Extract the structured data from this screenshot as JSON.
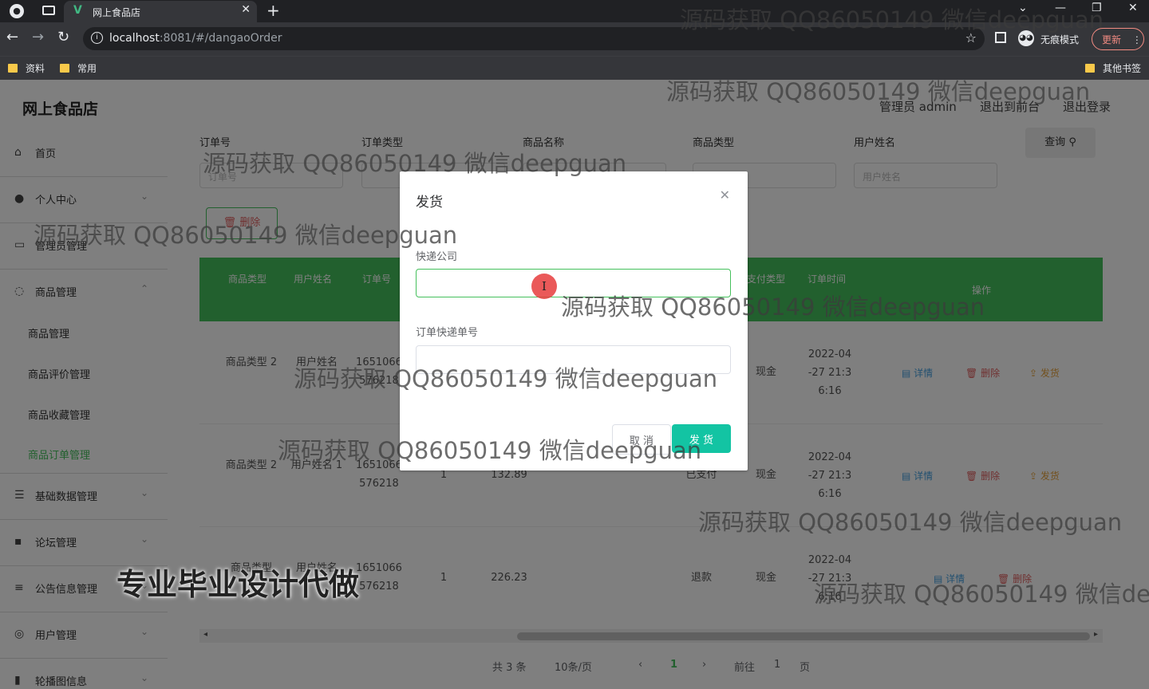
{
  "browser": {
    "tab_title": "网上食品店",
    "url_host": "localhost",
    "url_rest": ":8081/#/dangaoOrder",
    "incognito_label": "无痕模式",
    "update_label": "更新",
    "bookmarks": [
      "资料",
      "常用"
    ],
    "other_bookmarks": "其他书签"
  },
  "header": {
    "app_title": "网上食品店",
    "admin_label": "管理员 admin",
    "back_front": "退出到前台",
    "logout": "退出登录"
  },
  "sidebar": {
    "items": [
      {
        "label": "首页",
        "icon": "home-icon"
      },
      {
        "label": "个人中心",
        "icon": "user-icon"
      },
      {
        "label": "管理员管理",
        "icon": "id-card-icon"
      },
      {
        "label": "商品管理",
        "icon": "goods-icon"
      },
      {
        "label": "基础数据管理",
        "icon": "settings-icon"
      },
      {
        "label": "论坛管理",
        "icon": "forum-icon"
      },
      {
        "label": "公告信息管理",
        "icon": "list-icon"
      },
      {
        "label": "用户管理",
        "icon": "users-icon"
      },
      {
        "label": "轮播图信息",
        "icon": "chart-icon"
      }
    ],
    "sub_items": [
      "商品管理",
      "商品评价管理",
      "商品收藏管理",
      "商品订单管理"
    ]
  },
  "search": {
    "labels": [
      "订单号",
      "订单类型",
      "商品名称",
      "商品类型",
      "用户姓名"
    ],
    "placeholders": [
      "订单号",
      "",
      "",
      "商品类型",
      "用户姓名"
    ],
    "query_button": "查询",
    "delete_button": "删除"
  },
  "table": {
    "headers": [
      "商品类型",
      "用户姓名",
      "订单号",
      "",
      "",
      "",
      "支付类型",
      "订单时间",
      "操作"
    ],
    "rows": [
      {
        "type": "商品类型 2",
        "user": "用户姓名",
        "order": "1651066 576218",
        "qty": "",
        "price": "",
        "status": "",
        "pay": "现金",
        "time": "2022-04 -27 21:3 6:16"
      },
      {
        "type": "商品类型 2",
        "user": "用户姓名 1",
        "order": "1651066 576218",
        "qty": "1",
        "price": "132.89",
        "status": "已支付",
        "pay": "现金",
        "time": "2022-04 -27 21:3 6:16"
      },
      {
        "type": "商品类型",
        "user": "用户姓名",
        "order": "1651066 576218",
        "qty": "1",
        "price": "226.23",
        "status": "退款",
        "pay": "现金",
        "time": "2022-04 -27 21:3 6:16"
      }
    ],
    "actions": {
      "detail": "详情",
      "delete": "删除",
      "ship": "发货"
    }
  },
  "pagination": {
    "total": "共 3 条",
    "page_size": "10条/页",
    "current": "1",
    "goto": "前往",
    "goto_value": "1",
    "page_unit": "页"
  },
  "dialog": {
    "title": "发货",
    "courier_label": "快递公司",
    "courier_value": "",
    "tracking_label": "订单快递单号",
    "tracking_value": "",
    "cancel": "取 消",
    "confirm": "发 货"
  },
  "watermarks": {
    "text": "源码获取 QQ86050149 微信deepguan",
    "big": "专业毕业设计代做"
  },
  "colors": {
    "primary_green": "#45c05c",
    "confirm_teal": "#13c4a3",
    "danger": "#e06060",
    "warning": "#e6a23c"
  }
}
